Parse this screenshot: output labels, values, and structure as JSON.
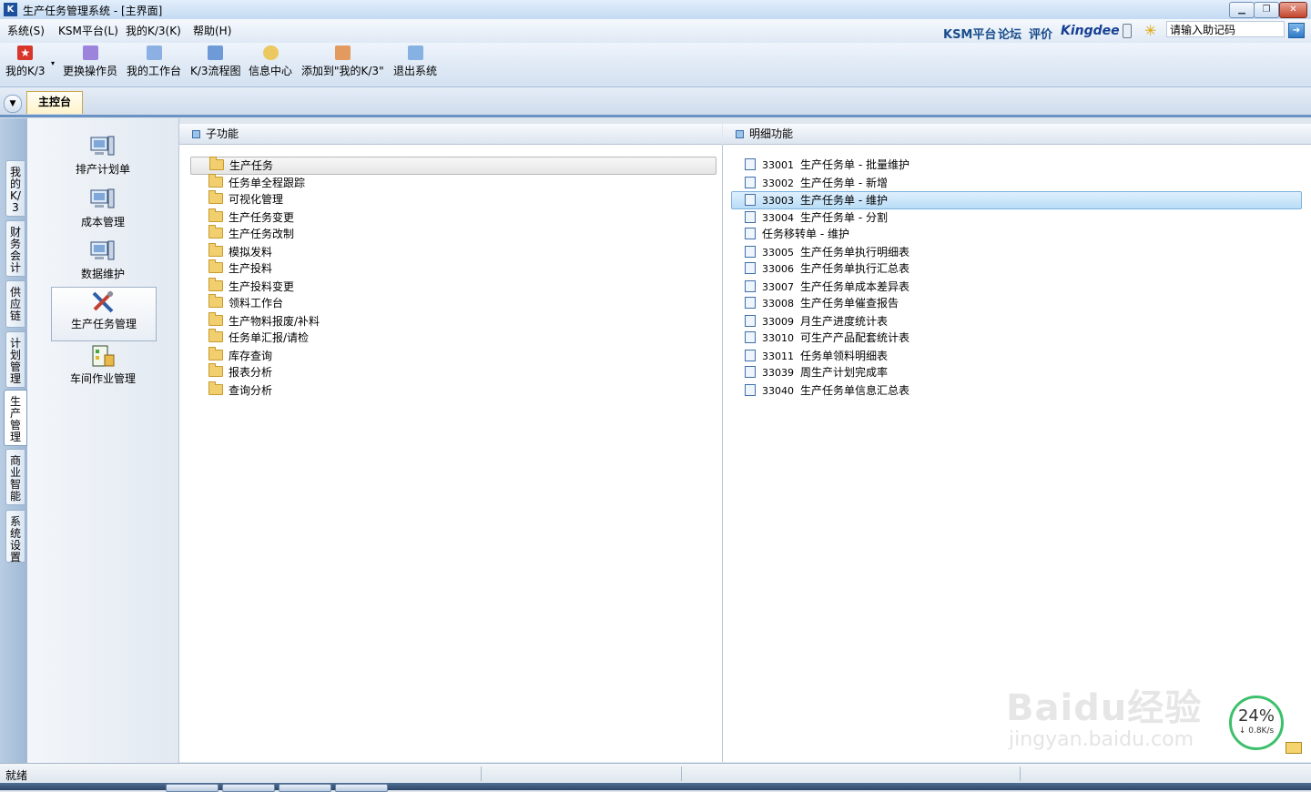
{
  "window": {
    "title": "生产任务管理系统 - [主界面]",
    "icon_label": "K",
    "controls": {
      "minimize": "▁",
      "maximize": "❐",
      "close": "✕"
    }
  },
  "menubar": {
    "items": [
      "系统(S)",
      "KSM平台(L)",
      "我的K/3(K)",
      "帮助(H)"
    ],
    "links": [
      "KSM平台",
      "论坛",
      "评价"
    ],
    "brand": "Kingdee",
    "helpcode_placeholder": "请输入助记码",
    "go_icon": "arrow-right-icon"
  },
  "toolbar": {
    "buttons": [
      {
        "label": "我的K/3",
        "icon": "star-icon",
        "color": "#d9362b"
      },
      {
        "label": "更换操作员",
        "icon": "users-icon",
        "color": "#7a5cc7"
      },
      {
        "label": "我的工作台",
        "icon": "pencil-icon",
        "color": "#5b8ad3"
      },
      {
        "label": "K/3流程图",
        "icon": "flowchart-icon",
        "color": "#3d79c9"
      },
      {
        "label": "信息中心",
        "icon": "message-icon",
        "color": "#e3b23c"
      },
      {
        "label": "添加到\"我的K/3\"",
        "icon": "add-favorite-icon",
        "color": "#d07a3a"
      },
      {
        "label": "退出系统",
        "icon": "exit-icon",
        "color": "#4f88cc"
      }
    ]
  },
  "tabbar": {
    "tabs": [
      "主控台"
    ]
  },
  "vertical_tabs": [
    {
      "label": "我的K/3",
      "active": false
    },
    {
      "label": "财务会计",
      "active": false
    },
    {
      "label": "供应链",
      "active": false
    },
    {
      "label": "计划管理",
      "active": false
    },
    {
      "label": "生产管理",
      "active": true
    },
    {
      "label": "商业智能",
      "active": false
    },
    {
      "label": "系统设置",
      "active": false
    }
  ],
  "nav": {
    "items": [
      {
        "label": "排产计划单",
        "icon": "computer-icon",
        "selected": false
      },
      {
        "label": "成本管理",
        "icon": "computer-icon",
        "selected": false
      },
      {
        "label": "数据维护",
        "icon": "computer-icon",
        "selected": false
      },
      {
        "label": "生产任务管理",
        "icon": "tools-icon",
        "selected": true
      },
      {
        "label": "车间作业管理",
        "icon": "workshop-icon",
        "selected": false
      }
    ]
  },
  "subfunctions": {
    "header": "子功能",
    "items": [
      {
        "label": "生产任务",
        "selected": true
      },
      {
        "label": "任务单全程跟踪"
      },
      {
        "label": "可视化管理"
      },
      {
        "label": "生产任务变更"
      },
      {
        "label": "生产任务改制"
      },
      {
        "label": "模拟发料"
      },
      {
        "label": "生产投料"
      },
      {
        "label": "生产投料变更"
      },
      {
        "label": "领料工作台"
      },
      {
        "label": "生产物料报废/补料"
      },
      {
        "label": "任务单汇报/请检"
      },
      {
        "label": "库存查询"
      },
      {
        "label": "报表分析"
      },
      {
        "label": "查询分析"
      }
    ]
  },
  "details": {
    "header": "明细功能",
    "items": [
      {
        "code": "33001",
        "label": "生产任务单 - 批量维护"
      },
      {
        "code": "33002",
        "label": "生产任务单 - 新增"
      },
      {
        "code": "33003",
        "label": "生产任务单 - 维护",
        "selected": true
      },
      {
        "code": "33004",
        "label": "生产任务单 - 分割"
      },
      {
        "code": "",
        "label": "任务移转单 - 维护"
      },
      {
        "code": "33005",
        "label": "生产任务单执行明细表"
      },
      {
        "code": "33006",
        "label": "生产任务单执行汇总表"
      },
      {
        "code": "33007",
        "label": "生产任务单成本差异表"
      },
      {
        "code": "33008",
        "label": "生产任务单催查报告"
      },
      {
        "code": "33009",
        "label": "月生产进度统计表"
      },
      {
        "code": "33010",
        "label": "可生产产品配套统计表"
      },
      {
        "code": "33011",
        "label": "任务单领料明细表"
      },
      {
        "code": "33039",
        "label": "周生产计划完成率"
      },
      {
        "code": "33040",
        "label": "生产任务单信息汇总表"
      }
    ]
  },
  "status": {
    "text": "就绪"
  },
  "overlay": {
    "speed_percent": "24%",
    "speed_rate": "↓ 0.8K/s",
    "watermark": "Baidu经验",
    "watermark_url": "jingyan.baidu.com"
  }
}
